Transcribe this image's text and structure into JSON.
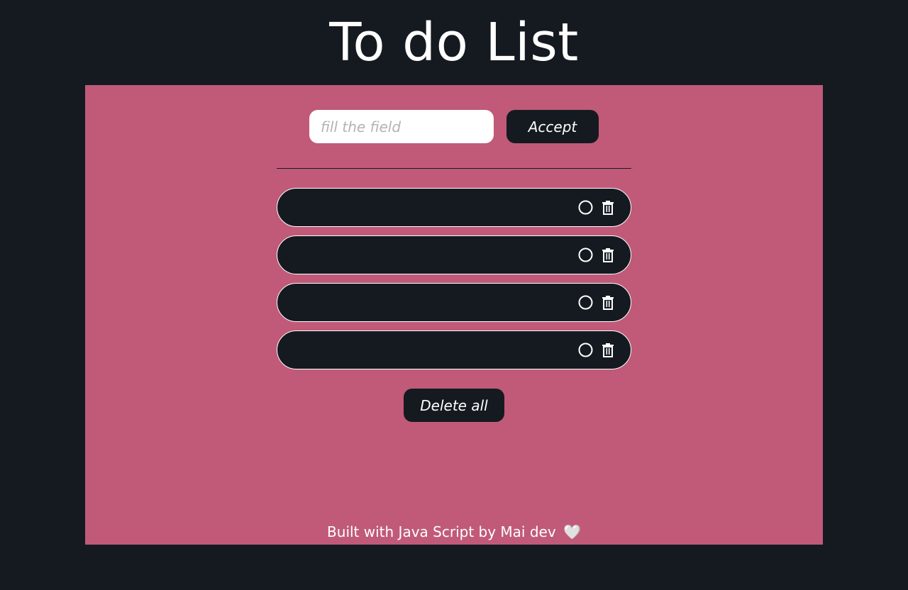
{
  "header": {
    "title": "To do List"
  },
  "form": {
    "input_value": "",
    "input_placeholder": "fill the field",
    "accept_label": "Accept"
  },
  "tasks": [
    {
      "text": "",
      "check_icon": "circle-outline-icon",
      "delete_icon": "trash-icon"
    },
    {
      "text": "",
      "check_icon": "circle-outline-icon",
      "delete_icon": "trash-icon"
    },
    {
      "text": "",
      "check_icon": "circle-outline-icon",
      "delete_icon": "trash-icon"
    },
    {
      "text": "",
      "check_icon": "circle-outline-icon",
      "delete_icon": "trash-icon"
    }
  ],
  "actions": {
    "delete_all_label": "Delete all"
  },
  "footer": {
    "text": "Built with Java Script by Mai dev",
    "heart": "🤍"
  },
  "colors": {
    "background": "#151a20",
    "panel": "#c05a78",
    "button": "#151a20",
    "text": "#ffffff"
  }
}
